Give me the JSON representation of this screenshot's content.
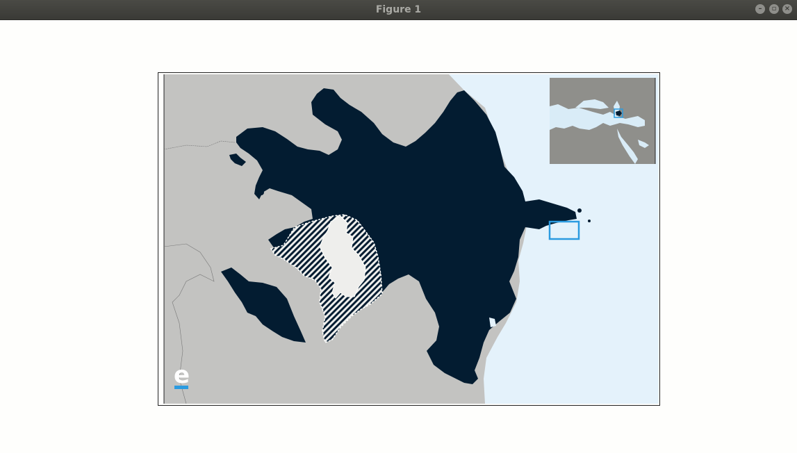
{
  "window": {
    "title": "Figure 1",
    "buttons": [
      "minimize",
      "maximize",
      "close"
    ]
  },
  "map": {
    "region": "Azerbaijan",
    "colors": {
      "land_other": "#c3c3c1",
      "sea": "#e4f2fb",
      "country": "#031c31",
      "occupied_light": "#eeeeec",
      "hatch": "#031c31",
      "locator_box": "#2b9be0",
      "inset_land": "#8f8f8b",
      "inset_sea": "#d9ecf7"
    },
    "logo": {
      "letter": "e",
      "accent_color": "#2b9be0"
    },
    "inset": {
      "description": "Locator map with highlighted country and box"
    }
  }
}
